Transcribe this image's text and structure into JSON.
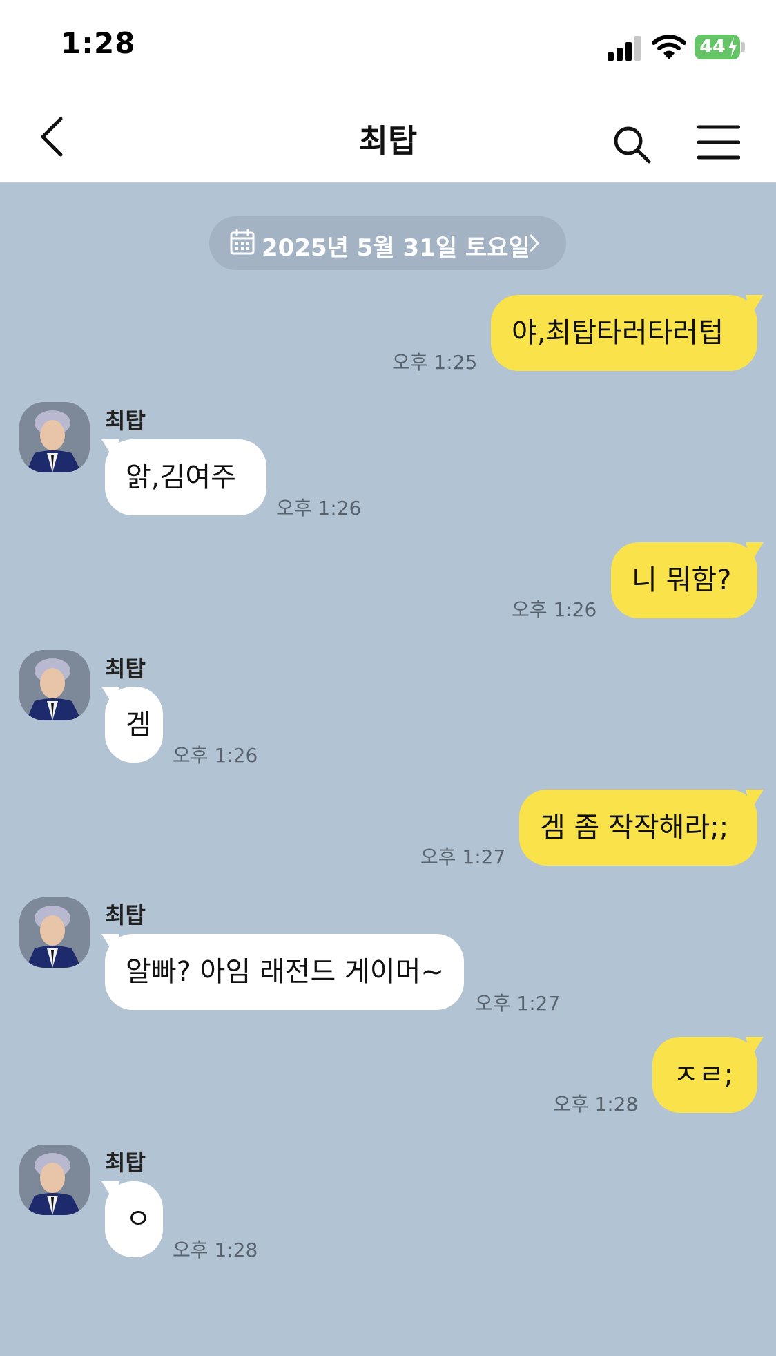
{
  "status_bar": {
    "time": "1:28",
    "battery_level": "44"
  },
  "header": {
    "title": "최탑"
  },
  "date_chip": {
    "label": "2025년 5월 31일 토요일"
  },
  "messages": [
    {
      "from": "me",
      "text": "야,최탑타러타러텁",
      "time": "오후 1:25"
    },
    {
      "from": "them",
      "sender": "최탑",
      "text": "앍,김여주",
      "time": "오후 1:26"
    },
    {
      "from": "me",
      "text": "니 뭐함?",
      "time": "오후 1:26"
    },
    {
      "from": "them",
      "sender": "최탑",
      "text": "겜",
      "time": "오후 1:26"
    },
    {
      "from": "me",
      "text": "겜 좀 작작해라;;",
      "time": "오후 1:27"
    },
    {
      "from": "them",
      "sender": "최탑",
      "text": "알빠? 아임 래전드 게이머~",
      "time": "오후 1:27"
    },
    {
      "from": "me",
      "text": "ㅈㄹ;",
      "time": "오후 1:28"
    },
    {
      "from": "them",
      "sender": "최탑",
      "text": "ㅇ",
      "time": "오후 1:28"
    }
  ],
  "colors": {
    "chat_bg": "#b2c3d3",
    "my_bubble": "#fae34a",
    "their_bubble": "#ffffff",
    "battery": "#65c466"
  }
}
